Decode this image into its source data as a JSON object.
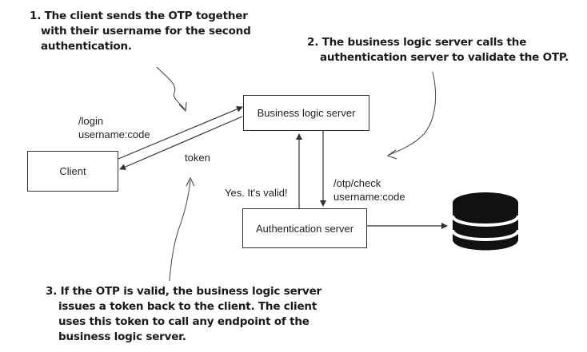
{
  "annotations": {
    "step1": [
      "1. The client sends the OTP together",
      "with their username for the second",
      "authentication."
    ],
    "step2": [
      "2. The business logic server calls the",
      "authentication server to validate the OTP."
    ],
    "step3": [
      "3. If the OTP is valid, the business logic server",
      "issues a token back to the client. The client",
      "uses this token to call any endpoint of the",
      "business logic server."
    ]
  },
  "nodes": {
    "client": "Client",
    "business_logic_server": "Business logic server",
    "authentication_server": "Authentication server"
  },
  "edge_labels": {
    "login": [
      "/login",
      "username:code"
    ],
    "token": "token",
    "otp_check": [
      "/otp/check",
      "username:code"
    ],
    "valid": "Yes. It's valid!"
  },
  "icons": {
    "database": "database-icon"
  },
  "colors": {
    "line": "#333333",
    "database": "#111111"
  }
}
